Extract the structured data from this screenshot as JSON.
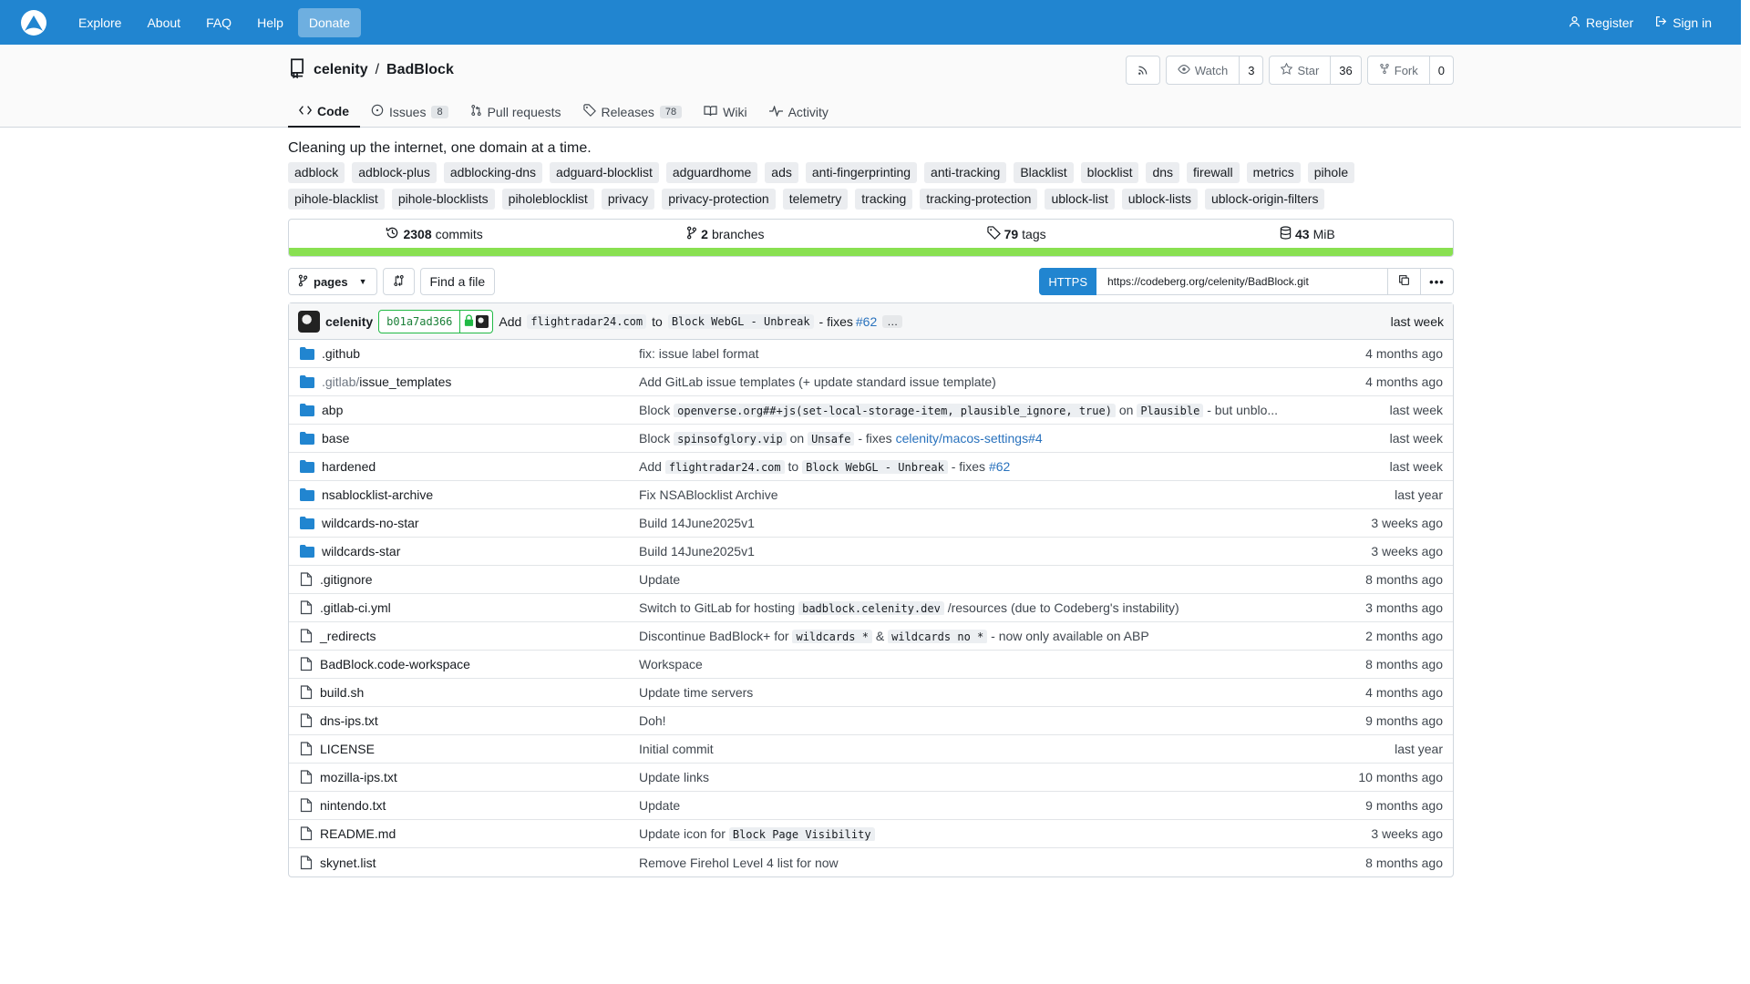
{
  "nav": {
    "items": [
      "Explore",
      "About",
      "FAQ",
      "Help"
    ],
    "donate": "Donate",
    "register": "Register",
    "signin": "Sign in"
  },
  "repo": {
    "owner": "celenity",
    "separator": "/",
    "name": "BadBlock",
    "watch_label": "Watch",
    "watch_count": "3",
    "star_label": "Star",
    "star_count": "36",
    "fork_label": "Fork",
    "fork_count": "0"
  },
  "tabs": {
    "code": "Code",
    "issues": "Issues",
    "issues_count": "8",
    "pulls": "Pull requests",
    "releases": "Releases",
    "releases_count": "78",
    "wiki": "Wiki",
    "activity": "Activity"
  },
  "description": "Cleaning up the internet, one domain at a time.",
  "topics": [
    "adblock",
    "adblock-plus",
    "adblocking-dns",
    "adguard-blocklist",
    "adguardhome",
    "ads",
    "anti-fingerprinting",
    "anti-tracking",
    "Blacklist",
    "blocklist",
    "dns",
    "firewall",
    "metrics",
    "pihole",
    "pihole-blacklist",
    "pihole-blocklists",
    "piholeblocklist",
    "privacy",
    "privacy-protection",
    "telemetry",
    "tracking",
    "tracking-protection",
    "ublock-list",
    "ublock-lists",
    "ublock-origin-filters"
  ],
  "stats": {
    "commits_num": "2308",
    "commits_label": "commits",
    "branches_num": "2",
    "branches_label": "branches",
    "tags_num": "79",
    "tags_label": "tags",
    "size_num": "43",
    "size_label": "MiB"
  },
  "toolbar": {
    "branch": "pages",
    "find_file": "Find a file",
    "clone_proto": "HTTPS",
    "clone_url": "https://codeberg.org/celenity/BadBlock.git"
  },
  "latest_commit": {
    "author": "celenity",
    "sha": "b01a7ad366",
    "w_add": "Add",
    "code1": "flightradar24.com",
    "w_to": "to",
    "code2": "Block WebGL - Unbreak",
    "w_fixes": "- fixes",
    "issue": "#62",
    "time": "last week"
  },
  "files": [
    {
      "icon": "folder-icon",
      "name_dim": "",
      "name": ".github",
      "msg": "fix: issue label format",
      "age": "4 months ago"
    },
    {
      "icon": "folder-icon",
      "name_dim": ".gitlab/",
      "name": "issue_templates",
      "msg": "Add GitLab issue templates (+ update standard issue template)",
      "age": "4 months ago"
    },
    {
      "icon": "folder-icon",
      "name_dim": "",
      "name": "abp",
      "msg": "",
      "age": "last week"
    },
    {
      "icon": "folder-icon",
      "name_dim": "",
      "name": "base",
      "msg": "",
      "age": "last week"
    },
    {
      "icon": "folder-icon",
      "name_dim": "",
      "name": "hardened",
      "msg": "",
      "age": "last week"
    },
    {
      "icon": "folder-icon",
      "name_dim": "",
      "name": "nsablocklist-archive",
      "msg": "Fix NSABlocklist Archive",
      "age": "last year"
    },
    {
      "icon": "folder-icon",
      "name_dim": "",
      "name": "wildcards-no-star",
      "msg": "Build 14June2025v1",
      "age": "3 weeks ago"
    },
    {
      "icon": "folder-icon",
      "name_dim": "",
      "name": "wildcards-star",
      "msg": "Build 14June2025v1",
      "age": "3 weeks ago"
    },
    {
      "icon": "file-icon",
      "name_dim": "",
      "name": ".gitignore",
      "msg": "Update",
      "age": "8 months ago"
    },
    {
      "icon": "file-icon",
      "name_dim": "",
      "name": ".gitlab-ci.yml",
      "msg": "",
      "age": "3 months ago"
    },
    {
      "icon": "file-icon",
      "name_dim": "",
      "name": "_redirects",
      "msg": "",
      "age": "2 months ago"
    },
    {
      "icon": "file-icon",
      "name_dim": "",
      "name": "BadBlock.code-workspace",
      "msg": "Workspace",
      "age": "8 months ago"
    },
    {
      "icon": "file-icon",
      "name_dim": "",
      "name": "build.sh",
      "msg": "Update time servers",
      "age": "4 months ago"
    },
    {
      "icon": "file-icon",
      "name_dim": "",
      "name": "dns-ips.txt",
      "msg": "Doh!",
      "age": "9 months ago"
    },
    {
      "icon": "file-icon",
      "name_dim": "",
      "name": "LICENSE",
      "msg": "Initial commit",
      "age": "last year"
    },
    {
      "icon": "file-icon",
      "name_dim": "",
      "name": "mozilla-ips.txt",
      "msg": "Update links",
      "age": "10 months ago"
    },
    {
      "icon": "file-icon",
      "name_dim": "",
      "name": "nintendo.txt",
      "msg": "Update",
      "age": "9 months ago"
    },
    {
      "icon": "file-icon",
      "name_dim": "",
      "name": "README.md",
      "msg": "",
      "age": "3 weeks ago"
    },
    {
      "icon": "file-icon",
      "name_dim": "",
      "name": "skynet.list",
      "msg": "Remove Firehol Level 4 list for now",
      "age": "8 months ago"
    }
  ],
  "rich_msgs": {
    "abp": {
      "t1": "Block",
      "c1": "openverse.org##+js(set-local-storage-item, plausible_ignore, true)",
      "t2": "on",
      "c2": "Plausible",
      "t3": "- but unblo..."
    },
    "base": {
      "t1": "Block",
      "c1": "spinsofglory.vip",
      "t2": "on",
      "c2": "Unsafe",
      "t3": "- fixes",
      "link": "celenity/macos-settings#4"
    },
    "hardened": {
      "t1": "Add",
      "c1": "flightradar24.com",
      "t2": "to",
      "c2": "Block WebGL - Unbreak",
      "t3": "- fixes",
      "link": "#62"
    },
    "gitlabci": {
      "t1": "Switch to GitLab for hosting",
      "c1": "badblock.celenity.dev",
      "t2": "/resources (due to Codeberg's instability)"
    },
    "redirects": {
      "t1": "Discontinue BadBlock+ for",
      "c1": "wildcards *",
      "t2": "&",
      "c2": "wildcards no *",
      "t3": "- now only available on ABP"
    },
    "readme": {
      "t1": "Update icon for",
      "c1": "Block Page Visibility"
    }
  },
  "colors": {
    "accent": "#2185d0",
    "lang_bar": "#89e051",
    "folder": "#2185d0"
  }
}
